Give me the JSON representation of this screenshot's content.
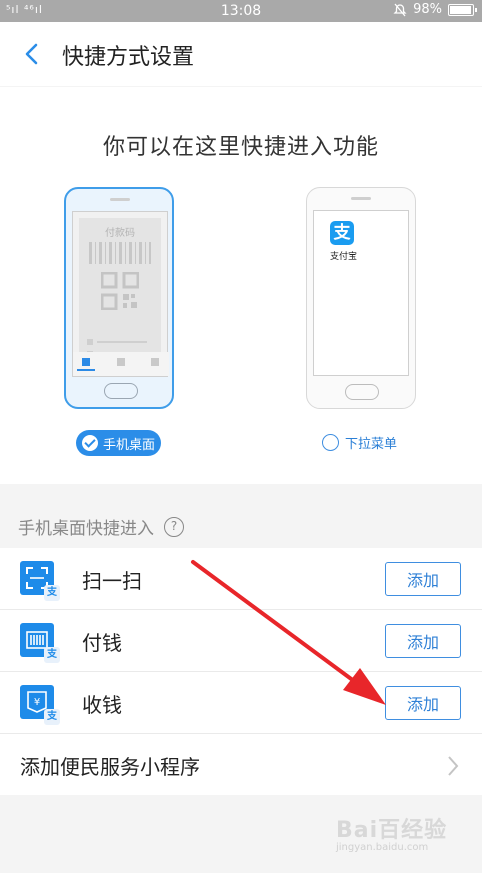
{
  "status_bar": {
    "signal": "⁵ıl ⁴⁶ıl",
    "time": "13:08",
    "battery": "98%",
    "battery_level": 0.98
  },
  "header": {
    "title": "快捷方式设置"
  },
  "hero": {
    "title": "你可以在这里快捷进入功能",
    "phone_left_card_label": "付款码",
    "phone_right_app_name": "支付宝",
    "phone_right_app_glyph": "支",
    "option_home": "手机桌面",
    "option_pulldown": "下拉菜单"
  },
  "section": {
    "label": "手机桌面快捷进入",
    "help_glyph": "?"
  },
  "shortcuts": [
    {
      "label": "扫一扫",
      "button": "添加",
      "icon": "scan-icon"
    },
    {
      "label": "付钱",
      "button": "添加",
      "icon": "barcode-icon"
    },
    {
      "label": "收钱",
      "button": "添加",
      "icon": "receive-money-icon"
    }
  ],
  "badge_glyph": "支",
  "more": {
    "label": "添加便民服务小程序"
  },
  "watermark": {
    "text": "Bai百经验",
    "sub": "jingyan.baidu.com"
  },
  "colors": {
    "accent": "#2b8de8",
    "annotation": "#e8262a"
  }
}
